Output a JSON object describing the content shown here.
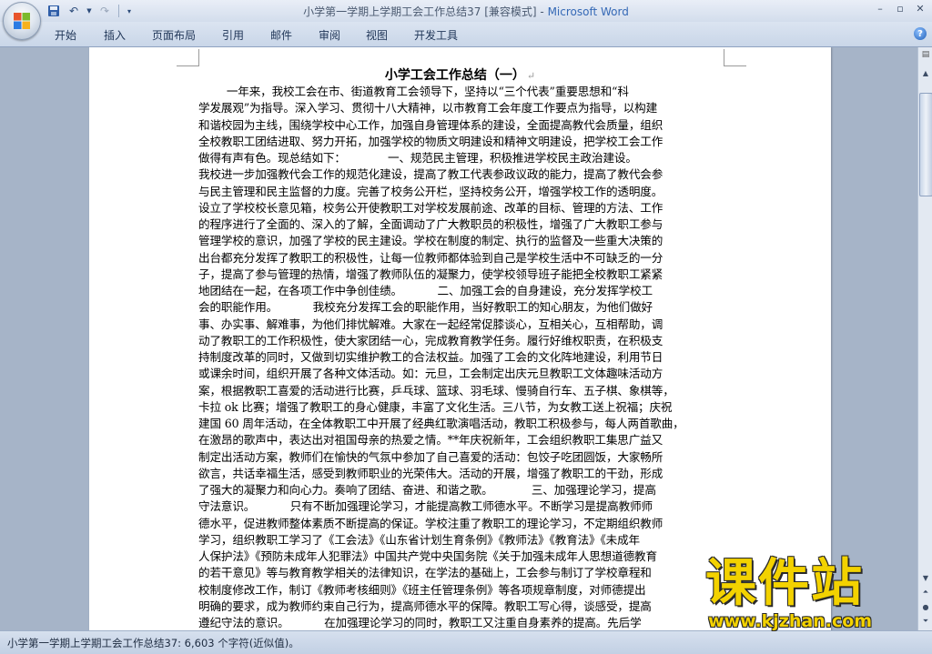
{
  "window": {
    "title_doc": "小学第一学期上学期工会工作总结37 [兼容模式]",
    "title_sep": " - ",
    "title_app": "Microsoft Word"
  },
  "ribbon": {
    "tabs": [
      "开始",
      "插入",
      "页面布局",
      "引用",
      "邮件",
      "审阅",
      "视图",
      "开发工具"
    ]
  },
  "document": {
    "title": "小学工会工作总结（一）",
    "lines": [
      "        一年来，我校工会在市、街道教育工会领导下，坚持以“三个代表”重要思想和“科",
      "学发展观”为指导。深入学习、贯彻十八大精神，以市教育工会年度工作要点为指导，以构建",
      "和谐校园为主线，围绕学校中心工作，加强自身管理体系的建设，全面提高教代会质量，组织",
      "全校教职工团结进取、努力开拓，加强学校的物质文明建设和精神文明建设，把学校工会工作",
      "做得有声有色。现总结如下：            一、规范民主管理，积极推进学校民主政治建设。",
      "我校进一步加强教代会工作的规范化建设，提高了教工代表参政议政的能力，提高了教代会参",
      "与民主管理和民主监督的力度。完善了校务公开栏，坚持校务公开，增强学校工作的透明度。",
      "设立了学校校长意见箱，校务公开使教职工对学校发展前途、改革的目标、管理的方法、工作",
      "的程序进行了全面的、深入的了解，全面调动了广大教职员的积极性，增强了广大教职工参与",
      "管理学校的意识，加强了学校的民主建设。学校在制度的制定、执行的监督及一些重大决策的",
      "出台都充分发挥了教职工的积极性，让每一位教师都体验到自己是学校生活中不可缺乏的一分",
      "子，提高了参与管理的热情，增强了教师队伍的凝聚力，使学校领导班子能把全校教职工紧紧",
      "地团结在一起，在各项工作中争创佳绩。          二、加强工会的自身建设，充分发挥学校工",
      "会的职能作用。          我校充分发挥工会的职能作用，当好教职工的知心朋友，为他们做好",
      "事、办实事、解难事，为他们排忧解难。大家在一起经常促膝谈心，互相关心，互相帮助，调",
      "动了教职工的工作积极性，使大家团结一心，完成教育教学任务。履行好维权职责，在积极支",
      "持制度改革的同时，又做到切实维护教工的合法权益。加强了工会的文化阵地建设，利用节日",
      "或课余时间，组织开展了各种文体活动。如：元旦，工会制定出庆元旦教职工文体趣味活动方",
      "案，根据教职工喜爱的活动进行比赛，乒乓球、篮球、羽毛球、慢骑自行车、五子棋、象棋等，",
      "卡拉 ok 比赛；增强了教职工的身心健康，丰富了文化生活。三八节，为女教工送上祝福；庆祝",
      "建国 60 周年活动，在全体教职工中开展了经典红歌演唱活动，教职工积极参与，每人两首歌曲，",
      "在激昂的歌声中，表达出对祖国母亲的热爱之情。**年庆祝新年，工会组织教职工集思广益又",
      "制定出活动方案，教师们在愉快的气氛中参加了自己喜爱的活动：包饺子吃团圆饭，大家畅所",
      "欲言，共话幸福生活，感受到教师职业的光荣伟大。活动的开展，增强了教职工的干劲，形成",
      "了强大的凝聚力和向心力。奏响了团结、奋进、和谐之歌。           三、加强理论学习，提高",
      "守法意识。          只有不断加强理论学习，才能提高教工师德水平。不断学习是提高教师师",
      "德水平，促进教师整体素质不断提高的保证。学校注重了教职工的理论学习，不定期组织教师",
      "学习，组织教职工学习了《工会法》《山东省计划生育条例》《教师法》《教育法》《未成年",
      "人保护法》《预防未成年人犯罪法》中国共产党中央国务院《关于加强未成年人思想道德教育",
      "的若干意见》等与教育教学相关的法律知识，在学法的基础上，工会参与制订了学校章程和",
      "校制度修改工作，制订《教师考核细则》《班主任管理条例》等各项规章制度，对师德提出",
      "明确的要求，成为教师约束自己行为，提高师德水平的保障。教职工写心得，谈感受，提高",
      "遵纪守法的意识。          在加强理论学习的同时，教职工又注重自身素养的提高。先后学"
    ]
  },
  "statusbar": {
    "text": "小学第一学期上学期工会工作总结37: 6,603 个字符(近似值)。"
  },
  "watermark": {
    "main": "课件站",
    "url": "www.kjzhan.com"
  }
}
